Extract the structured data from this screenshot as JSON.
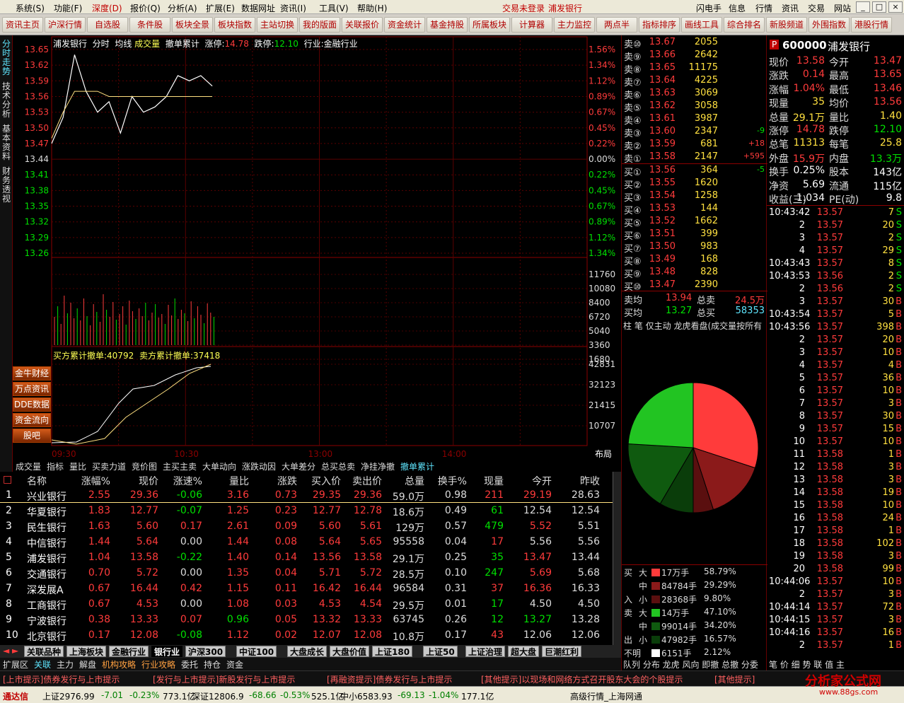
{
  "menu": {
    "items": [
      "系统(S)",
      "功能(F)",
      "深度(D)",
      "报价(Q)",
      "分析(A)",
      "扩展(E)",
      "数据网址",
      "资讯(I)",
      "工具(V)",
      "帮助(H)"
    ],
    "notice": "交易未登录",
    "stock": "浦发银行",
    "right_buttons": [
      "闪电手",
      "信息",
      "行情",
      "资讯",
      "交易",
      "网站"
    ],
    "win": [
      "_",
      "□",
      "×"
    ]
  },
  "toolbar": [
    "资讯主页",
    "沪深行情",
    "自选股",
    "条件股",
    "板块全景",
    "板块指数",
    "主站切换",
    "我的版面",
    "关联报价",
    "资金统计",
    "基金持股",
    "所属板块",
    "计算器",
    "主力监控",
    "两点半",
    "指标排序",
    "画线工具",
    "综合排名",
    "新股频道",
    "外围指数",
    "港股行情"
  ],
  "lefttabs": [
    "分时走势",
    "技术分析",
    "基本资料",
    "财务透视"
  ],
  "chart": {
    "header": {
      "name": "浦发银行",
      "fs": "分时",
      "avg": "均线",
      "vol": "成交量",
      "cancel": "撤单累计",
      "zt_label": "涨停:",
      "zt": "14.78",
      "dt_label": "跌停:",
      "dt": "12.10",
      "ind": "行业:金融行业"
    },
    "price_ticks": [
      "13.65",
      "13.62",
      "13.59",
      "13.56",
      "13.53",
      "13.50",
      "13.47",
      "13.44",
      "13.41",
      "13.38",
      "13.35",
      "13.32",
      "13.29",
      "13.26"
    ],
    "pct_ticks": [
      "1.56%",
      "1.34%",
      "1.12%",
      "0.89%",
      "0.67%",
      "0.45%",
      "0.22%",
      "0.00%",
      "0.22%",
      "0.45%",
      "0.67%",
      "0.89%",
      "1.12%",
      "1.34%"
    ],
    "vol_ticks": [
      "11760",
      "10080",
      "8400",
      "6720",
      "5040",
      "3360",
      "1680"
    ],
    "cancel_label_buy": "买方累计撤单:40792",
    "cancel_label_sell": "卖方累计撤单:37418",
    "cancel_ticks": [
      "42831",
      "32123",
      "21415",
      "10707"
    ],
    "time_ticks": [
      "09:30",
      "10:30",
      "13:00",
      "14:00"
    ],
    "layout_label": "布局",
    "side_buttons": [
      "金牛财经",
      "万点资讯",
      "DDE数据",
      "资金流向",
      "股吧"
    ],
    "subtabs": [
      "成交量",
      "指标",
      "量比",
      "买卖力道",
      "竞价图",
      "主买主卖",
      "大单动向",
      "涨跌动因",
      "大单差分",
      "总买总卖",
      "净挂净撤",
      "撤单累计"
    ]
  },
  "table": {
    "headers": [
      "名称",
      "涨幅%",
      "现价",
      "涨速%",
      "量比",
      "涨跌",
      "买入价",
      "卖出价",
      "总量",
      "换手%",
      "现量",
      "今开",
      "昨收"
    ],
    "rows": [
      [
        "1",
        "兴业银行",
        "2.55",
        "29.36",
        "-0.06",
        "3.16",
        "0.73",
        "29.35",
        "29.36",
        "59.0万",
        "0.98",
        "211",
        "29.19",
        "28.63"
      ],
      [
        "2",
        "华夏银行",
        "1.83",
        "12.77",
        "-0.07",
        "1.25",
        "0.23",
        "12.77",
        "12.78",
        "18.6万",
        "0.49",
        "61",
        "12.54",
        "12.54"
      ],
      [
        "3",
        "民生银行",
        "1.63",
        "5.60",
        "0.17",
        "2.61",
        "0.09",
        "5.60",
        "5.61",
        "129万",
        "0.57",
        "479",
        "5.52",
        "5.51"
      ],
      [
        "4",
        "中信银行",
        "1.44",
        "5.64",
        "0.00",
        "1.44",
        "0.08",
        "5.64",
        "5.65",
        "95558",
        "0.04",
        "17",
        "5.56",
        "5.56"
      ],
      [
        "5",
        "浦发银行",
        "1.04",
        "13.58",
        "-0.22",
        "1.40",
        "0.14",
        "13.56",
        "13.58",
        "29.1万",
        "0.25",
        "35",
        "13.47",
        "13.44"
      ],
      [
        "6",
        "交通银行",
        "0.70",
        "5.72",
        "0.00",
        "1.35",
        "0.04",
        "5.71",
        "5.72",
        "28.5万",
        "0.10",
        "247",
        "5.69",
        "5.68"
      ],
      [
        "7",
        "深发展A",
        "0.67",
        "16.44",
        "0.42",
        "1.15",
        "0.11",
        "16.42",
        "16.44",
        "96584",
        "0.31",
        "37",
        "16.36",
        "16.33"
      ],
      [
        "8",
        "工商银行",
        "0.67",
        "4.53",
        "0.00",
        "1.08",
        "0.03",
        "4.53",
        "4.54",
        "29.5万",
        "0.01",
        "17",
        "4.50",
        "4.50"
      ],
      [
        "9",
        "宁波银行",
        "0.38",
        "13.33",
        "0.07",
        "0.96",
        "0.05",
        "13.32",
        "13.33",
        "63745",
        "0.26",
        "12",
        "13.27",
        "13.28"
      ],
      [
        "10",
        "北京银行",
        "0.17",
        "12.08",
        "-0.08",
        "1.12",
        "0.02",
        "12.07",
        "12.08",
        "10.8万",
        "0.17",
        "43",
        "12.06",
        "12.06"
      ]
    ]
  },
  "blocktabs": [
    "关联品种",
    "上海板块",
    "金融行业",
    "银行业",
    "沪深300",
    "中证100",
    "大盘成长",
    "大盘价值",
    "上证180",
    "上证50",
    "上证治理",
    "超大盘",
    "巨潮红利"
  ],
  "bottomtabs": [
    "扩展区",
    "关联",
    "主力",
    "解盘",
    "机构攻略",
    "行业攻略",
    "委托",
    "持仓",
    "资金"
  ],
  "orderbook": {
    "sell": [
      [
        "卖⑩",
        "13.67",
        "2055",
        ""
      ],
      [
        "卖⑨",
        "13.66",
        "2642",
        ""
      ],
      [
        "卖⑧",
        "13.65",
        "11175",
        ""
      ],
      [
        "卖⑦",
        "13.64",
        "4225",
        ""
      ],
      [
        "卖⑥",
        "13.63",
        "3069",
        ""
      ],
      [
        "卖⑤",
        "13.62",
        "3058",
        ""
      ],
      [
        "卖④",
        "13.61",
        "3987",
        ""
      ],
      [
        "卖③",
        "13.60",
        "2347",
        "-9"
      ],
      [
        "卖②",
        "13.59",
        "681",
        "+18"
      ],
      [
        "卖①",
        "13.58",
        "2147",
        "+595"
      ]
    ],
    "buy": [
      [
        "买①",
        "13.56",
        "364",
        "-5"
      ],
      [
        "买②",
        "13.55",
        "1620",
        ""
      ],
      [
        "买③",
        "13.54",
        "1258",
        ""
      ],
      [
        "买④",
        "13.53",
        "144",
        ""
      ],
      [
        "买⑤",
        "13.52",
        "1662",
        ""
      ],
      [
        "买⑥",
        "13.51",
        "399",
        ""
      ],
      [
        "买⑦",
        "13.50",
        "983",
        ""
      ],
      [
        "买⑧",
        "13.49",
        "168",
        ""
      ],
      [
        "买⑨",
        "13.48",
        "828",
        ""
      ],
      [
        "买⑩",
        "13.47",
        "2390",
        ""
      ]
    ],
    "summary": [
      [
        "卖均",
        "13.94",
        "总卖",
        "24.5万"
      ],
      [
        "买均",
        "13.27",
        "总买",
        "58353"
      ]
    ],
    "pie_tabs": "柱 笔 仅主动 龙虎看盘(成交量按所有",
    "flows": [
      [
        "买",
        "大",
        "17万手",
        "58.79%"
      ],
      [
        "",
        "中",
        "84784手",
        "29.29%"
      ],
      [
        "入",
        "小",
        "28368手",
        "9.80%"
      ],
      [
        "卖",
        "大",
        "14万手",
        "47.10%"
      ],
      [
        "",
        "中",
        "99014手",
        "34.20%"
      ],
      [
        "出",
        "小",
        "47982手",
        "16.57%"
      ],
      [
        "不明",
        "",
        "6151手",
        "2.12%"
      ]
    ],
    "pie": [
      {
        "label": "买大",
        "value": 58.79,
        "color": "#ff3b3b"
      },
      {
        "label": "买中",
        "value": 29.29,
        "color": "#8b1a1a"
      },
      {
        "label": "买小",
        "value": 9.8,
        "color": "#5a0f0f"
      },
      {
        "label": "卖小",
        "value": 16.57,
        "color": "#0a3d0a"
      },
      {
        "label": "卖中",
        "value": 34.2,
        "color": "#0f5a0f"
      },
      {
        "label": "卖大",
        "value": 47.1,
        "color": "#22c422"
      }
    ],
    "bottom": "队列 分布 龙虎 风向 即撤 总撤 分委"
  },
  "quote": {
    "code": "600000",
    "name": "浦发银行",
    "p": "P",
    "fields": [
      [
        "现价",
        "13.58",
        "今开",
        "13.47"
      ],
      [
        "涨跌",
        "0.14",
        "最高",
        "13.65"
      ],
      [
        "涨幅",
        "1.04%",
        "最低",
        "13.46"
      ],
      [
        "现量",
        "35",
        "均价",
        "13.56"
      ],
      [
        "总量",
        "29.1万",
        "量比",
        "1.40"
      ],
      [
        "涨停",
        "14.78",
        "跌停",
        "12.10"
      ],
      [
        "总笔",
        "11313",
        "每笔",
        "25.8"
      ],
      [
        "外盘",
        "15.9万",
        "内盘",
        "13.3万"
      ],
      [
        "换手",
        "0.25%",
        "股本",
        "143亿"
      ],
      [
        "净资",
        "5.69",
        "流通",
        "115亿"
      ],
      [
        "收益(三)",
        "1.034",
        "PE(动)",
        "9.8"
      ]
    ],
    "ticks": [
      [
        "10:43:42",
        "13.57",
        "7",
        "S"
      ],
      [
        "2",
        "13.57",
        "20",
        "S"
      ],
      [
        "3",
        "13.57",
        "2",
        "S"
      ],
      [
        "4",
        "13.57",
        "29",
        "S"
      ],
      [
        "10:43:43",
        "13.57",
        "8",
        "S"
      ],
      [
        "10:43:53",
        "13.56",
        "2",
        "S"
      ],
      [
        "2",
        "13.56",
        "2",
        "S"
      ],
      [
        "3",
        "13.57",
        "30",
        "B"
      ],
      [
        "10:43:54",
        "13.57",
        "5",
        "B"
      ],
      [
        "10:43:56",
        "13.57",
        "398",
        "B"
      ],
      [
        "2",
        "13.57",
        "20",
        "B"
      ],
      [
        "3",
        "13.57",
        "10",
        "B"
      ],
      [
        "4",
        "13.57",
        "4",
        "B"
      ],
      [
        "5",
        "13.57",
        "36",
        "B"
      ],
      [
        "6",
        "13.57",
        "10",
        "B"
      ],
      [
        "7",
        "13.57",
        "3",
        "B"
      ],
      [
        "8",
        "13.57",
        "30",
        "B"
      ],
      [
        "9",
        "13.57",
        "15",
        "B"
      ],
      [
        "10",
        "13.57",
        "10",
        "B"
      ],
      [
        "11",
        "13.58",
        "1",
        "B"
      ],
      [
        "12",
        "13.58",
        "3",
        "B"
      ],
      [
        "13",
        "13.58",
        "3",
        "B"
      ],
      [
        "14",
        "13.58",
        "19",
        "B"
      ],
      [
        "15",
        "13.58",
        "10",
        "B"
      ],
      [
        "16",
        "13.58",
        "24",
        "B"
      ],
      [
        "17",
        "13.58",
        "1",
        "B"
      ],
      [
        "18",
        "13.58",
        "102",
        "B"
      ],
      [
        "19",
        "13.58",
        "3",
        "B"
      ],
      [
        "20",
        "13.58",
        "99",
        "B"
      ],
      [
        "10:44:06",
        "13.57",
        "10",
        "B"
      ],
      [
        "2",
        "13.57",
        "3",
        "B"
      ],
      [
        "10:44:14",
        "13.57",
        "72",
        "B"
      ],
      [
        "10:44:15",
        "13.57",
        "3",
        "B"
      ],
      [
        "10:44:16",
        "13.57",
        "16",
        "B"
      ],
      [
        "2",
        "13.57",
        "1",
        "B"
      ]
    ],
    "bottom_tabs": "笔 价 细 势 联 值 主"
  },
  "ticker": [
    "[上市提示]债券发行与上市提示",
    "[发行与上市提示]新股发行与上市提示",
    "[再融资提示]债券发行与上市提示",
    "[其他提示]以现场和网络方式召开股东大会的个股提示",
    "[其他提示]"
  ],
  "status": {
    "app": "通达信",
    "sh": "上证2976.99",
    "sh_chg": "-7.01",
    "sh_pct": "-0.23%",
    "sh_amt": "773.1亿",
    "sz": "深证12806.9",
    "sz_chg": "-68.66",
    "sz_pct": "-0.53%",
    "sz_amt": "525.1亿",
    "zx": "中小6583.93",
    "zx_chg": "-69.13",
    "zx_pct": "-1.04%",
    "zx_amt": "177.1亿",
    "hq": "高级行情_上海网通",
    "logo": "分析家公式网",
    "logo_url": "www.88gs.com"
  },
  "chart_data": {
    "type": "line",
    "price_line": {
      "x": [
        "09:30",
        "09:35",
        "09:40",
        "09:45",
        "09:50",
        "09:55",
        "10:00",
        "10:05",
        "10:10",
        "10:15",
        "10:20",
        "10:25",
        "10:30",
        "10:35",
        "10:40"
      ],
      "values": [
        13.47,
        13.52,
        13.64,
        13.57,
        13.53,
        13.55,
        13.49,
        13.56,
        13.53,
        13.54,
        13.56,
        13.6,
        13.59,
        13.6,
        13.58
      ]
    },
    "avg_line": {
      "values": [
        13.48,
        13.53,
        13.57,
        13.57,
        13.57,
        13.56,
        13.56,
        13.56,
        13.56,
        13.56,
        13.56,
        13.56,
        13.56,
        13.56,
        13.56
      ]
    },
    "ylim": [
      13.26,
      13.65
    ]
  }
}
